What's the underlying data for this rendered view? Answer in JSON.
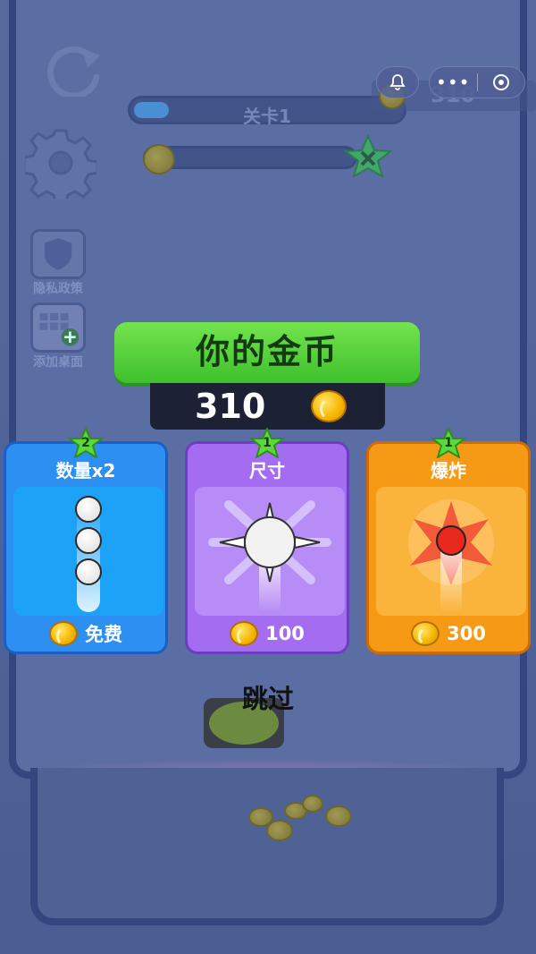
{
  "background": {
    "level_label": "关卡1",
    "level_progress": 0.13,
    "side_buttons": [
      {
        "label": "隐私政策",
        "icon": "shield-icon"
      },
      {
        "label": "添加桌面",
        "icon": "add-desktop-icon"
      }
    ],
    "top_coin_count": "310"
  },
  "overlay": {
    "title": "你的金币",
    "coin_amount": "310",
    "skip_label": "跳过",
    "cards": [
      {
        "name": "数量x2",
        "level": "2",
        "price": "免费",
        "color": "#2c8ff1",
        "icon": "three-balls-icon"
      },
      {
        "name": "尺寸",
        "level": "1",
        "price": "100",
        "color": "#a46cf0",
        "icon": "spiky-ball-icon"
      },
      {
        "name": "爆炸",
        "level": "1",
        "price": "300",
        "color": "#f69a16",
        "icon": "explosion-ball-icon"
      }
    ]
  },
  "colors": {
    "banner_green": "#4fd038",
    "coin_gold": "#f5b400",
    "scene_blue": "#56699f"
  }
}
